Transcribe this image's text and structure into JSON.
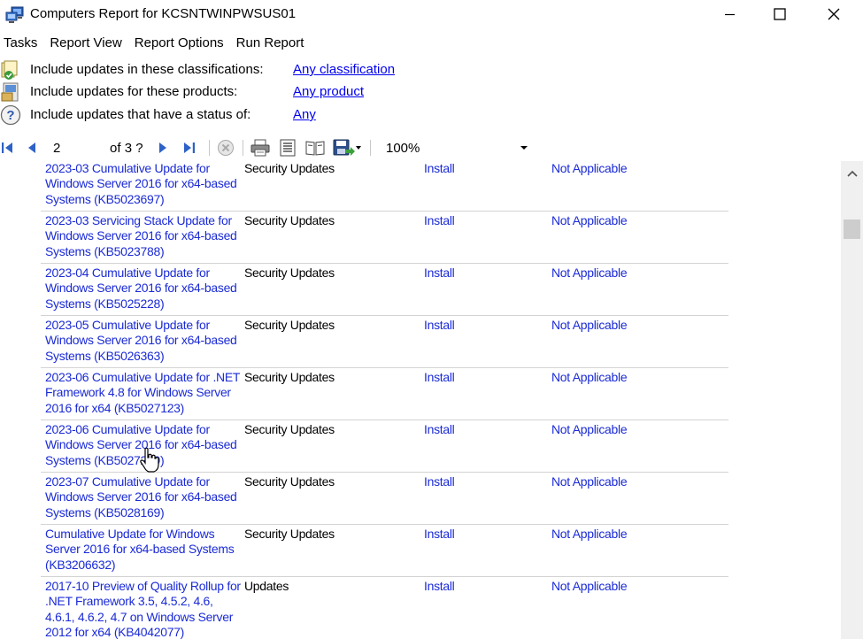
{
  "window": {
    "title": "Computers Report for KCSNTWINPWSUS01",
    "icon": "wsus-computers-icon",
    "controls": [
      "minimize-icon",
      "maximize-icon",
      "close-icon"
    ]
  },
  "menu": [
    "Tasks",
    "Report View",
    "Report Options",
    "Run Report"
  ],
  "filters": [
    {
      "label": "Include updates in these classifications:",
      "value": "Any classification",
      "icon": "classification-icon"
    },
    {
      "label": "Include updates for these products:",
      "value": "Any product",
      "icon": "product-icon"
    },
    {
      "label": "Include updates that have a status of:",
      "value": "Any",
      "icon": "help-question-icon"
    }
  ],
  "toolbar": {
    "current_page": "2",
    "of_label": "of",
    "total_pages": "3 ?",
    "zoom": "100%"
  },
  "rows": [
    {
      "title": "2023-03 Cumulative Update for Windows Server 2016 for x64-based Systems (KB5023697)",
      "classification": "Security Updates",
      "approval": "Install",
      "status": "Not Applicable"
    },
    {
      "title": "2023-03 Servicing Stack Update for Windows Server 2016 for x64-based Systems (KB5023788)",
      "classification": "Security Updates",
      "approval": "Install",
      "status": "Not Applicable"
    },
    {
      "title": "2023-04 Cumulative Update for Windows Server 2016 for x64-based Systems (KB5025228)",
      "classification": "Security Updates",
      "approval": "Install",
      "status": "Not Applicable"
    },
    {
      "title": "2023-05 Cumulative Update for Windows Server 2016 for x64-based Systems (KB5026363)",
      "classification": "Security Updates",
      "approval": "Install",
      "status": "Not Applicable"
    },
    {
      "title": "2023-06 Cumulative Update for .NET Framework 4.8 for Windows Server 2016 for x64 (KB5027123)",
      "classification": "Security Updates",
      "approval": "Install",
      "status": "Not Applicable"
    },
    {
      "title": "2023-06 Cumulative Update for Windows Server 2016 for x64-based Systems (KB5027219)",
      "classification": "Security Updates",
      "approval": "Install",
      "status": "Not Applicable"
    },
    {
      "title": "2023-07 Cumulative Update for Windows Server 2016 for x64-based Systems (KB5028169)",
      "classification": "Security Updates",
      "approval": "Install",
      "status": "Not Applicable"
    },
    {
      "title": "Cumulative Update for Windows Server 2016 for x64-based Systems (KB3206632)",
      "classification": "Security Updates",
      "approval": "Install",
      "status": "Not Applicable"
    },
    {
      "title": "2017-10 Preview of Quality Rollup for .NET Framework 3.5, 4.5.2, 4.6, 4.6.1, 4.6.2, 4.7 on Windows Server 2012 for x64 (KB4042077)",
      "classification": "Updates",
      "approval": "Install",
      "status": "Not Applicable"
    }
  ]
}
